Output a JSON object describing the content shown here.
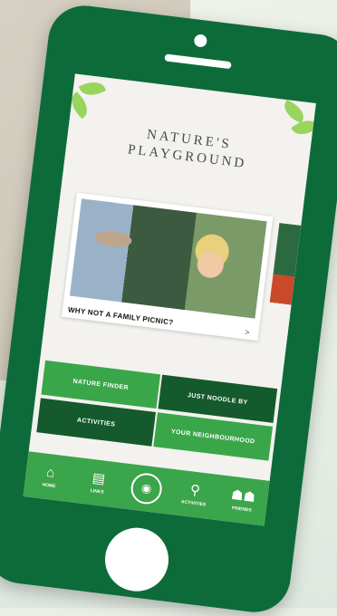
{
  "app": {
    "title": "NATURE'S\nPLAYGROUND"
  },
  "featured_card": {
    "caption": "WHY NOT A FAMILY PICNIC?",
    "arrow": ">"
  },
  "menu_tiles": [
    {
      "label": "Nature Finder",
      "style": "light"
    },
    {
      "label": "Just Noodle By",
      "style": "dark"
    },
    {
      "label": "Activities",
      "style": "dark"
    },
    {
      "label": "Your Neighbourhood",
      "style": "light"
    }
  ],
  "tabbar": {
    "items": [
      {
        "icon": "home-icon",
        "glyph": "⌂",
        "label": "HOME"
      },
      {
        "icon": "book-icon",
        "glyph": "▤",
        "label": "LINKS"
      },
      {
        "icon": "camera-icon",
        "glyph": "◉",
        "label": ""
      },
      {
        "icon": "map-pin-icon",
        "glyph": "⚲",
        "label": "ACTIVITIES"
      },
      {
        "icon": "people-icon",
        "glyph": "☗☗",
        "label": "FRIENDS"
      }
    ]
  },
  "colors": {
    "phone": "#0d6b3a",
    "tile_light": "#39a64a",
    "tile_dark": "#145a2c"
  }
}
